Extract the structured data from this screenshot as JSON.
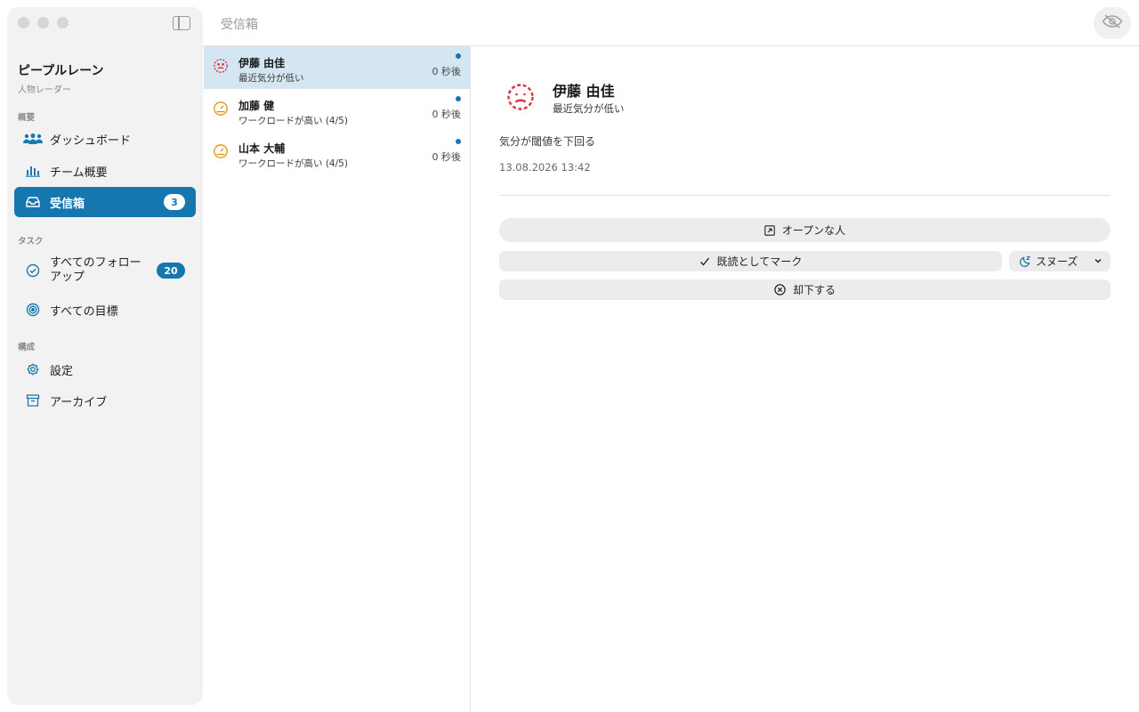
{
  "window": {
    "title": "受信箱"
  },
  "sidebar": {
    "app_title": "ピープルレーン",
    "app_subtitle": "人物レーダー",
    "sections": [
      {
        "label": "概要",
        "items": [
          {
            "label": "ダッシュボード",
            "icon": "people-icon"
          },
          {
            "label": "チーム概要",
            "icon": "bar-chart-icon"
          },
          {
            "label": "受信箱",
            "icon": "inbox-icon",
            "badge": "3",
            "active": true
          }
        ]
      },
      {
        "label": "タスク",
        "items": [
          {
            "label": "すべてのフォローアップ",
            "icon": "check-circle-icon",
            "badge": "20"
          },
          {
            "label": "すべての目標",
            "icon": "target-icon"
          }
        ]
      },
      {
        "label": "構成",
        "items": [
          {
            "label": "設定",
            "icon": "gear-icon"
          },
          {
            "label": "アーカイブ",
            "icon": "archive-icon"
          }
        ]
      }
    ]
  },
  "inbox": {
    "items": [
      {
        "name": "伊藤 由佳",
        "description": "最近気分が低い",
        "time": "0 秒後",
        "icon": "sad-face-icon",
        "icon_color": "#e0303a",
        "unread": true,
        "selected": true
      },
      {
        "name": "加藤 健",
        "description": "ワークロードが高い (4/5)",
        "time": "0 秒後",
        "icon": "gauge-icon",
        "icon_color": "#e8900c",
        "unread": true
      },
      {
        "name": "山本 大輔",
        "description": "ワークロードが高い (4/5)",
        "time": "0 秒後",
        "icon": "gauge-icon",
        "icon_color": "#e8900c",
        "unread": true
      }
    ]
  },
  "detail": {
    "name": "伊藤 由佳",
    "subtitle": "最近気分が低い",
    "message": "気分が閾値を下回る",
    "timestamp": "13.08.2026 13:42",
    "icon": "sad-face-icon",
    "icon_color": "#e0303a",
    "actions": {
      "open": "オープンな人",
      "mark_read": "既読としてマーク",
      "snooze": "スヌーズ",
      "dismiss": "却下する"
    }
  },
  "colors": {
    "accent": "#1577ad",
    "alert_red": "#e0303a",
    "warning_orange": "#e8900c",
    "selected_row": "#d3e6f1"
  }
}
